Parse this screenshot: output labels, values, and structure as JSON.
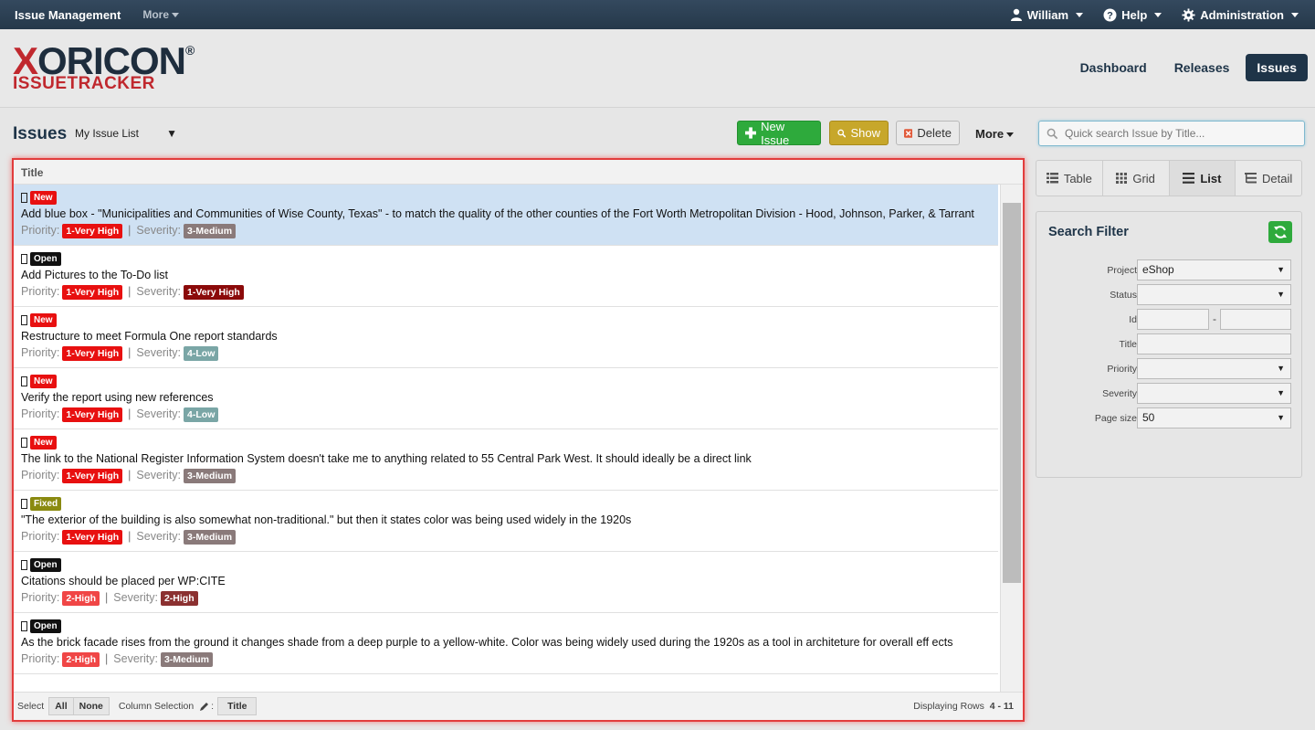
{
  "topbar": {
    "brand": "Issue Management",
    "more": "More",
    "user": "William",
    "help": "Help",
    "admin": "Administration"
  },
  "logo": {
    "line1_x": "X",
    "line1_rest": "ORICON",
    "reg": "®",
    "line2": "ISSUETRACKER"
  },
  "nav": {
    "dashboard": "Dashboard",
    "releases": "Releases",
    "issues": "Issues"
  },
  "toolbar": {
    "title": "Issues",
    "list_select": "My Issue List",
    "new_issue": "New Issue",
    "show": "Show",
    "delete": "Delete",
    "more": "More",
    "search_placeholder": "Quick search Issue by Title..."
  },
  "list": {
    "column_header": "Title",
    "priority_label": "Priority:",
    "severity_label": "Severity:",
    "rows": [
      {
        "status": "New",
        "title": "Add blue box - \"Municipalities and Communities of Wise County, Texas\" - to match the quality of the other counties of the Fort Worth Metropolitan Division - Hood, Johnson, Parker, & Tarrant",
        "priority": "1-Very High",
        "severity": "3-Medium"
      },
      {
        "status": "Open",
        "title": "Add Pictures to the To-Do list",
        "priority": "1-Very High",
        "severity": "1-Very High"
      },
      {
        "status": "New",
        "title": "Restructure to meet Formula One report standards",
        "priority": "1-Very High",
        "severity": "4-Low"
      },
      {
        "status": "New",
        "title": "Verify the report using new references",
        "priority": "1-Very High",
        "severity": "4-Low"
      },
      {
        "status": "New",
        "title": "The link to the National Register Information System doesn't take me to anything related to 55 Central Park West. It should ideally be a direct link",
        "priority": "1-Very High",
        "severity": "3-Medium"
      },
      {
        "status": "Fixed",
        "title": "\"The exterior of the building is also somewhat non-traditional.\" but then it states color was being used widely in the 1920s",
        "priority": "1-Very High",
        "severity": "3-Medium"
      },
      {
        "status": "Open",
        "title": "Citations should be placed per WP:CITE",
        "priority": "2-High",
        "severity": "2-High"
      },
      {
        "status": "Open",
        "title": "As the brick facade rises from the ground it changes shade from a deep purple to a yellow-white. Color was being widely used during the 1920s as a tool in architeture for overall eff ects",
        "priority": "2-High",
        "severity": "3-Medium"
      }
    ],
    "footer": {
      "select_label": "Select",
      "all": "All",
      "none": "None",
      "column_selection": "Column Selection",
      "column_title": "Title",
      "displaying_label": "Displaying Rows",
      "displaying_range": "4 - 11"
    }
  },
  "views": {
    "table": "Table",
    "grid": "Grid",
    "list": "List",
    "detail": "Detail"
  },
  "filter": {
    "title": "Search Filter",
    "project_label": "Project",
    "project_value": "eShop",
    "status_label": "Status",
    "id_label": "Id",
    "id_sep": "-",
    "title_label": "Title",
    "priority_label": "Priority",
    "severity_label": "Severity",
    "pagesize_label": "Page size",
    "pagesize_value": "50"
  },
  "colors": {
    "status_new": "#e81010",
    "status_open": "#111111",
    "status_fixed": "#8a8a10",
    "very_high": "#e81010",
    "very_high_severity": "#8b0a0a",
    "high": "#f04646",
    "high_severity": "#8b3030",
    "medium": "#8a7a7a",
    "low": "#7aa6a6"
  }
}
